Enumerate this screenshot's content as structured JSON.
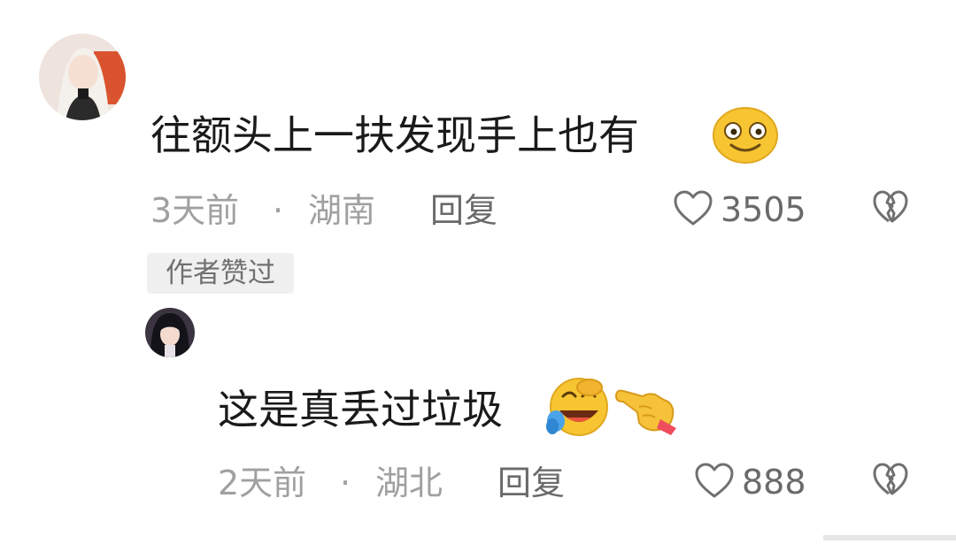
{
  "comments": [
    {
      "text": "往额头上一扶发现手上也有",
      "emojis": [
        "smiling-face-emoji"
      ],
      "time": "3天前",
      "separator": "·",
      "location": "湖南",
      "reply_label": "回复",
      "likes": "3505",
      "badge": "作者赞过"
    },
    {
      "text": "这是真丢过垃圾",
      "emojis": [
        "rolling-on-floor-laughing-emoji",
        "pointing-hand-emoji"
      ],
      "time": "2天前",
      "separator": "·",
      "location": "湖北",
      "reply_label": "回复",
      "likes": "888"
    }
  ],
  "colors": {
    "primary_text": "#1a1a1a",
    "meta_text": "#a0a0a0",
    "action_text": "#6a6a6a",
    "badge_bg": "#f0f0f0",
    "emoji_yellow": "#f7c531"
  },
  "icons": [
    "heart-outline-icon",
    "broken-heart-icon"
  ]
}
